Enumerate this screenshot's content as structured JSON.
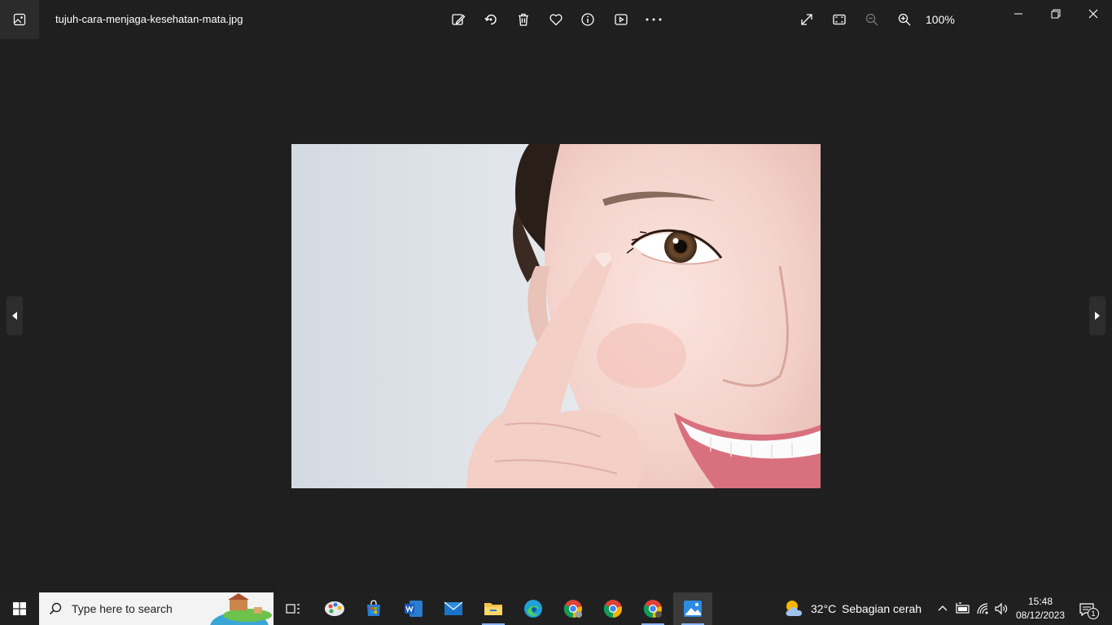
{
  "window": {
    "filename": "tujuh-cara-menjaga-kesehatan-mata.jpg",
    "zoom_level": "100%",
    "toolbar": [
      "edit-icon",
      "rotate-icon",
      "delete-icon",
      "favorite-icon",
      "info-icon",
      "slideshow-icon",
      "more-icon"
    ],
    "view_controls": [
      "fullscreen-icon",
      "fit-icon",
      "zoom-out-icon",
      "zoom-in-icon"
    ]
  },
  "taskbar": {
    "search_placeholder": "Type here to search",
    "apps": [
      "task-view",
      "paint-3d",
      "microsoft-store",
      "word",
      "mail",
      "file-explorer",
      "edge",
      "chrome-profile-1",
      "chrome",
      "chrome-profile-2",
      "photos"
    ],
    "weather": {
      "temp": "32°C",
      "condition": "Sebagian cerah"
    },
    "clock": {
      "time": "15:48",
      "date": "08/12/2023"
    },
    "notification_count": "1"
  },
  "colors": {
    "background": "#1f1f1f",
    "taskbar": "#202020",
    "accent": "#8ab4f8"
  }
}
